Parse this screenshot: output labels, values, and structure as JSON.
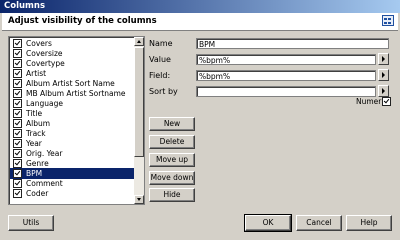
{
  "window": {
    "title": "Columns"
  },
  "header": {
    "title": "Adjust visibility of the columns",
    "icon": "columns-grid-icon"
  },
  "columns": {
    "items": [
      {
        "label": "Covers",
        "checked": true
      },
      {
        "label": "Coversize",
        "checked": true
      },
      {
        "label": "Covertype",
        "checked": true
      },
      {
        "label": "Artist",
        "checked": true
      },
      {
        "label": "Album Artist Sort Name",
        "checked": true
      },
      {
        "label": "MB Album Artist Sortname",
        "checked": true
      },
      {
        "label": "Language",
        "checked": true
      },
      {
        "label": "Title",
        "checked": true
      },
      {
        "label": "Album",
        "checked": true
      },
      {
        "label": "Track",
        "checked": true
      },
      {
        "label": "Year",
        "checked": true
      },
      {
        "label": "Orig. Year",
        "checked": true
      },
      {
        "label": "Genre",
        "checked": true
      },
      {
        "label": "BPM",
        "checked": true,
        "selected": true
      },
      {
        "label": "Comment",
        "checked": true
      },
      {
        "label": "Coder",
        "checked": true
      }
    ]
  },
  "form": {
    "name_label": "Name",
    "name_value": "BPM",
    "value_label": "Value",
    "value_value": "%bpm%",
    "field_label": "Field:",
    "field_value": "%bpm%",
    "sortby_label": "Sort by",
    "sortby_value": "",
    "numeric_label": "Numeric",
    "numeric_checked": true
  },
  "actions": {
    "new": "New",
    "delete": "Delete",
    "move_up": "Move up",
    "move_down": "Move down",
    "hide": "Hide"
  },
  "footer": {
    "utils": "Utils",
    "ok": "OK",
    "cancel": "Cancel",
    "help": "Help"
  }
}
